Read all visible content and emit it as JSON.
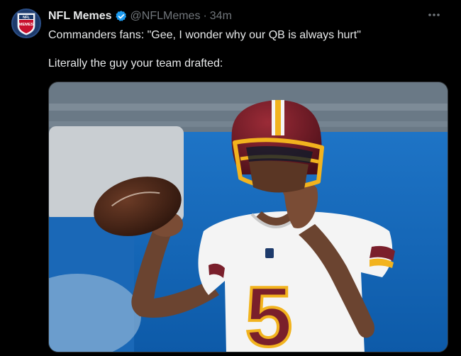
{
  "tweet": {
    "author_name": "NFL Memes",
    "handle": "@NFLMemes",
    "separator": "·",
    "time": "34m",
    "text_line_1": "Commanders fans: \"Gee, I wonder why our QB is always hurt\"",
    "text_line_2": "Literally the guy your team drafted:",
    "verified_icon": "verified-badge-icon",
    "more_icon": "more-horizontal-icon"
  },
  "avatar": {
    "logo_text_top": "NFL",
    "logo_text_bottom": "MEMES"
  },
  "media": {
    "jersey_number": "5"
  },
  "colors": {
    "background": "#000000",
    "text": "#e7e9ea",
    "secondary_text": "#71767b",
    "verified": "#1d9bf0",
    "burgundy": "#7a1f2b",
    "gold": "#f2b31e"
  }
}
